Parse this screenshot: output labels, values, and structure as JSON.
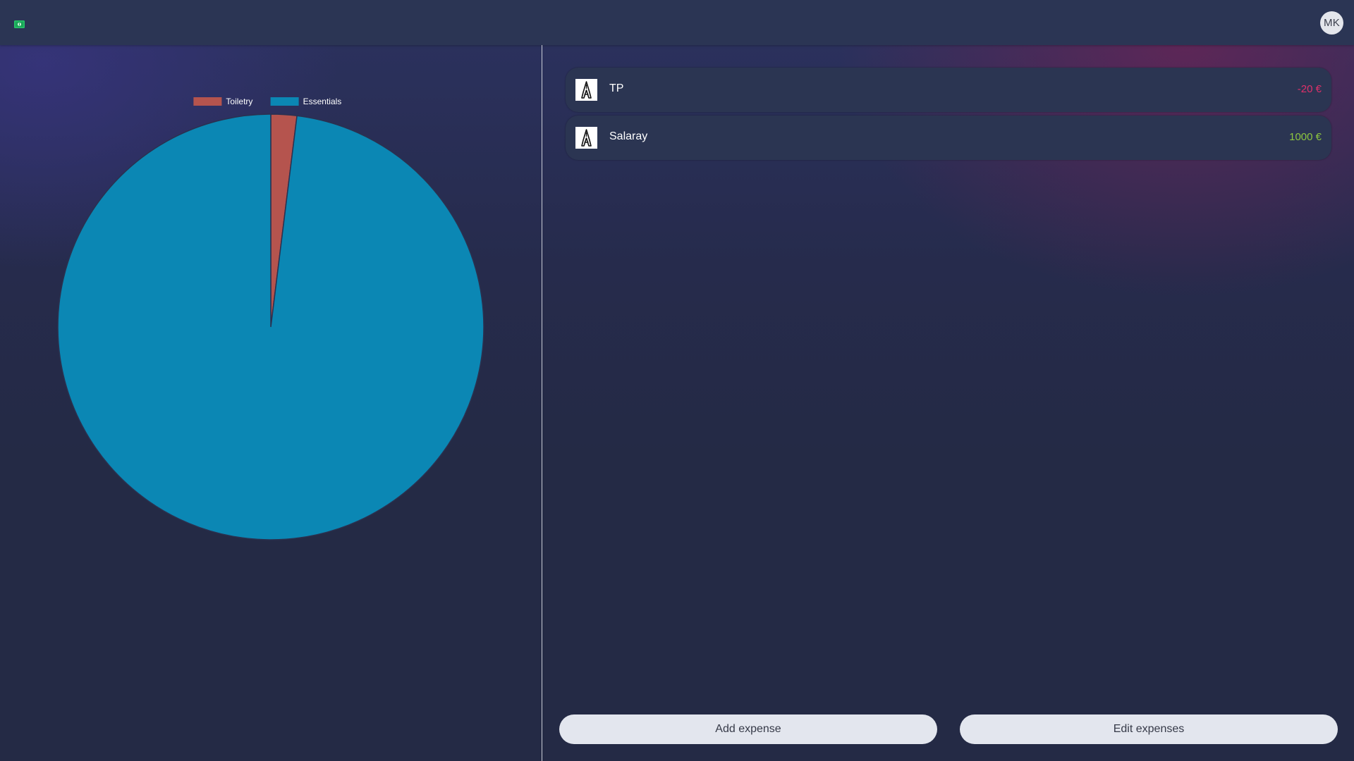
{
  "header": {
    "logo_icon": "money-icon",
    "avatar_initials": "MK"
  },
  "colors": {
    "toiletry": "#b5544e",
    "essentials": "#0b87b4",
    "negative_amount": "#e0306a",
    "positive_amount": "#8dc63f"
  },
  "chart_data": {
    "type": "pie",
    "legend": [
      "Toiletry",
      "Essentials"
    ],
    "legend_position": "top",
    "slices": [
      {
        "label": "Toiletry",
        "value": 20,
        "color": "#b5544e"
      },
      {
        "label": "Essentials",
        "value": 1000,
        "color": "#0b87b4"
      }
    ]
  },
  "transactions": [
    {
      "name": "TP",
      "amount": "-20 €",
      "type": "negative",
      "icon": "category-icon"
    },
    {
      "name": "Salaray",
      "amount": "1000 €",
      "type": "positive",
      "icon": "category-icon"
    }
  ],
  "actions": {
    "add_label": "Add expense",
    "edit_label": "Edit expenses"
  }
}
